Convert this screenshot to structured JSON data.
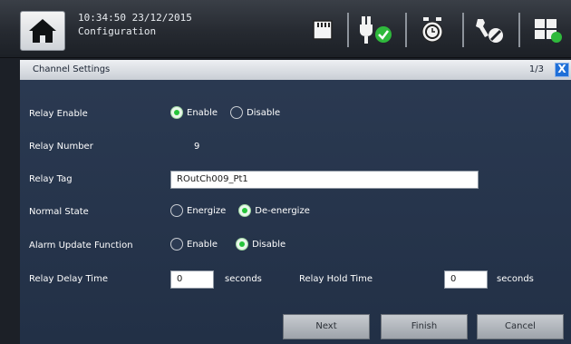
{
  "status": {
    "time": "10:34:50",
    "date": "23/12/2015",
    "screen": "Configuration"
  },
  "icons": [
    "home-icon",
    "memory-card-icon",
    "power-ok-icon",
    "alarm-clock-icon",
    "tools-icon",
    "display-layout-icon"
  ],
  "dialog": {
    "title": "Channel Settings",
    "page": "1/3",
    "close": "X"
  },
  "form": {
    "relay_enable": {
      "label": "Relay Enable",
      "options": [
        "Enable",
        "Disable"
      ],
      "selected": "Enable"
    },
    "relay_number": {
      "label": "Relay Number",
      "value": "9"
    },
    "relay_tag": {
      "label": "Relay Tag",
      "value": "ROutCh009_Pt1"
    },
    "normal_state": {
      "label": "Normal State",
      "options": [
        "Energize",
        "De-energize"
      ],
      "selected": "De-energize"
    },
    "alarm_update": {
      "label": "Alarm Update Function",
      "options": [
        "Enable",
        "Disable"
      ],
      "selected": "Disable"
    },
    "relay_delay": {
      "label": "Relay Delay Time",
      "value": "0",
      "unit": "seconds"
    },
    "relay_hold": {
      "label": "Relay Hold Time",
      "value": "0",
      "unit": "seconds"
    }
  },
  "buttons": {
    "next": "Next",
    "finish": "Finish",
    "cancel": "Cancel"
  },
  "colors": {
    "selected_radio": "#25c43a",
    "close_button": "#1e6fd8",
    "dialog_bg": "#2b3a52"
  }
}
